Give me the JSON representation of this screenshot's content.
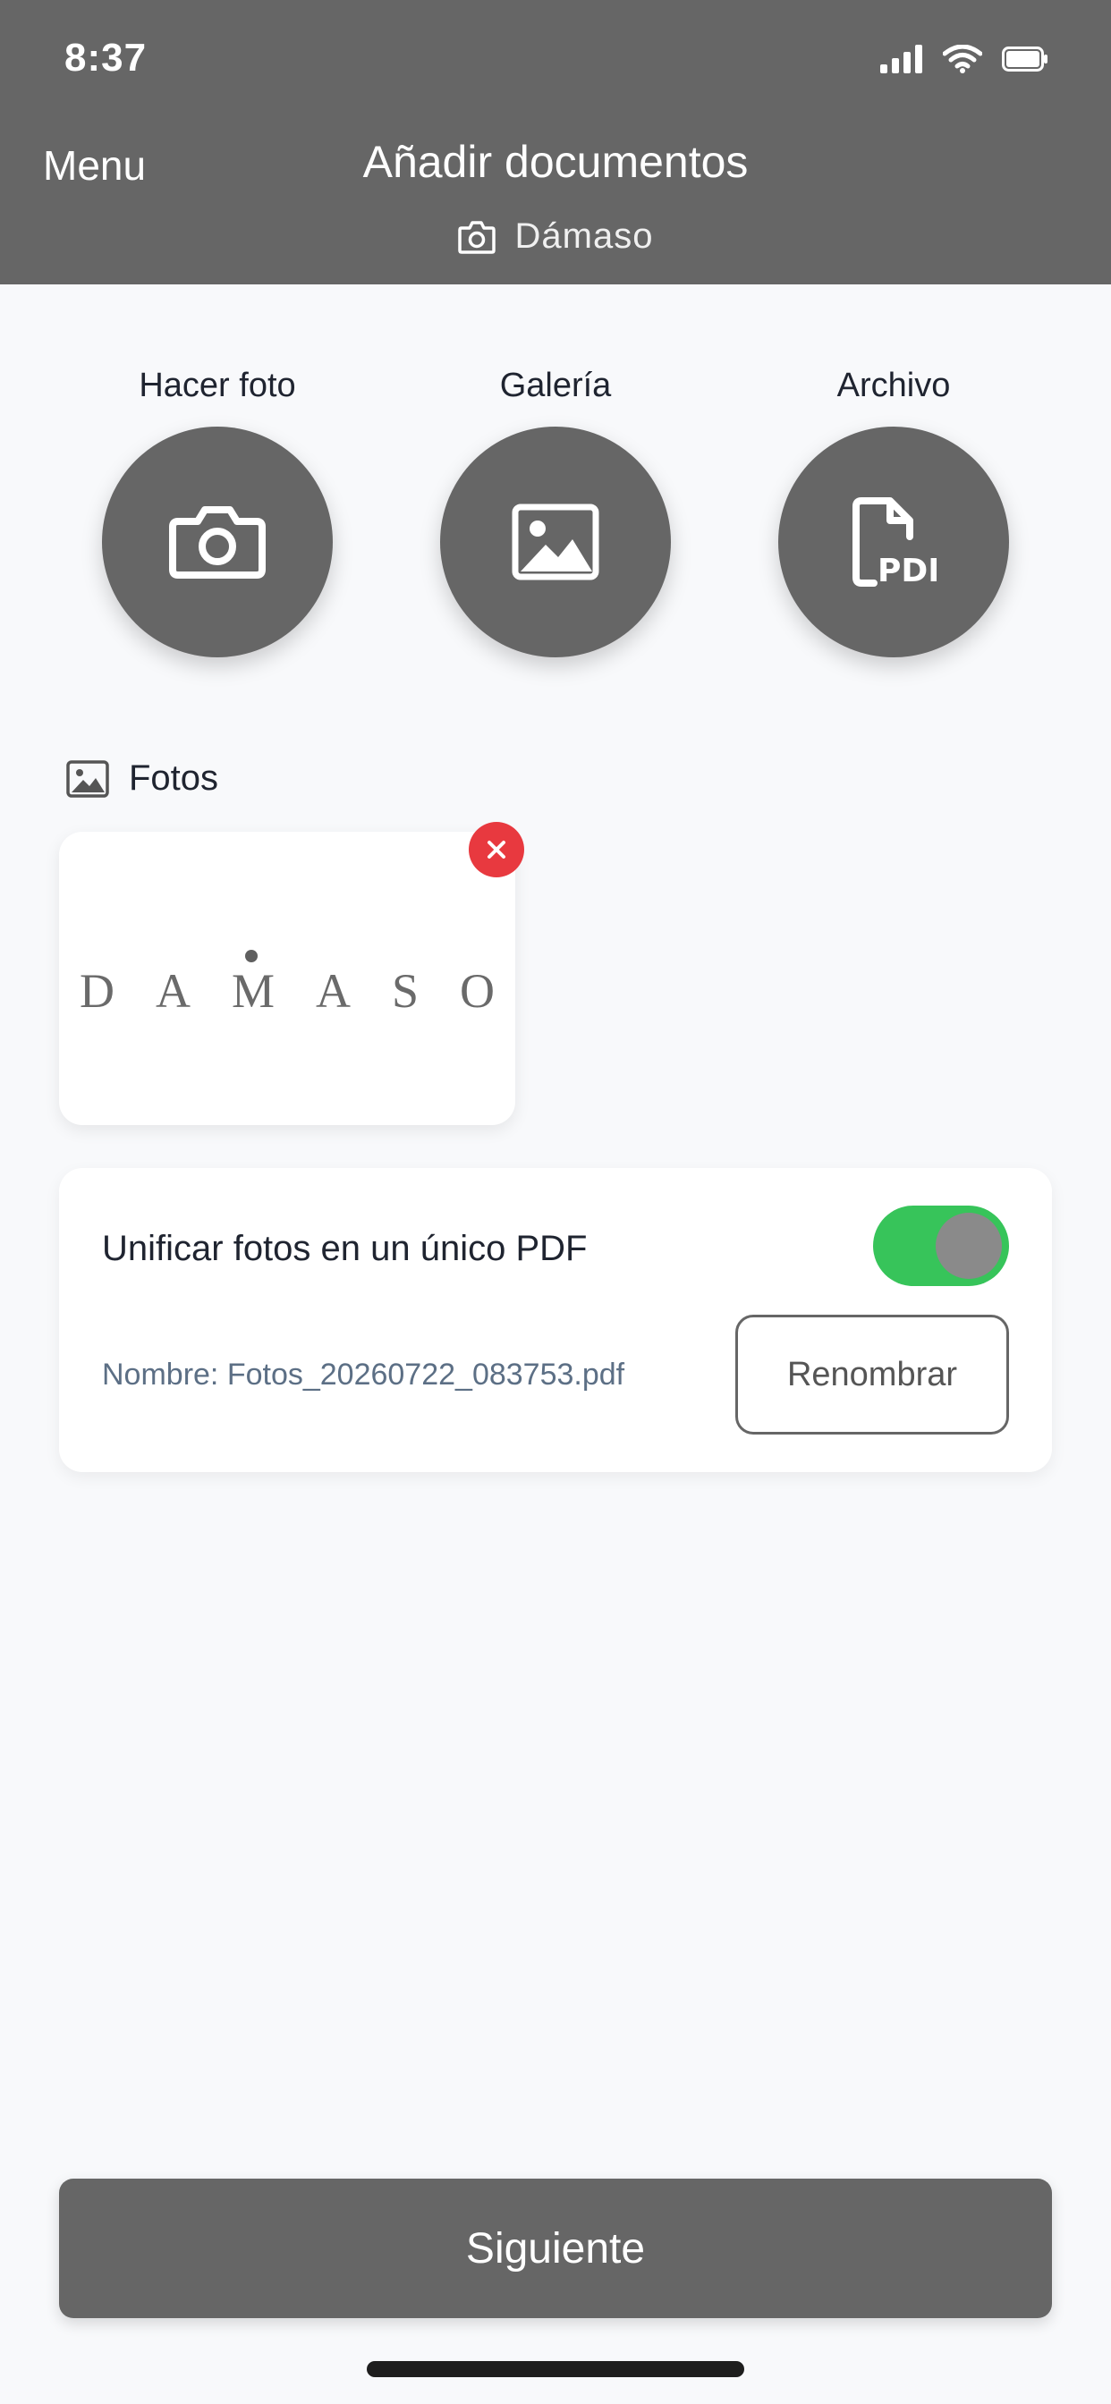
{
  "status_bar": {
    "time": "8:37"
  },
  "header": {
    "menu_label": "Menu",
    "title": "Añadir documentos",
    "subtitle": "Dámaso"
  },
  "actions": [
    {
      "label": "Hacer foto",
      "icon": "camera-icon"
    },
    {
      "label": "Galería",
      "icon": "image-icon"
    },
    {
      "label": "Archivo",
      "icon": "pdf-file-icon"
    }
  ],
  "photos": {
    "section_title": "Fotos",
    "items": [
      {
        "logo_text": "DAMASO"
      }
    ]
  },
  "options": {
    "unify_label": "Unificar fotos en un único PDF",
    "unify_enabled": true,
    "name_label": "Nombre: Fotos_20260722_083753.pdf",
    "rename_label": "Renombrar"
  },
  "footer": {
    "next_label": "Siguiente"
  },
  "colors": {
    "header_bg": "#666666",
    "toggle_on": "#37c45a",
    "remove": "#e8393f",
    "background": "#f8f9fb"
  }
}
